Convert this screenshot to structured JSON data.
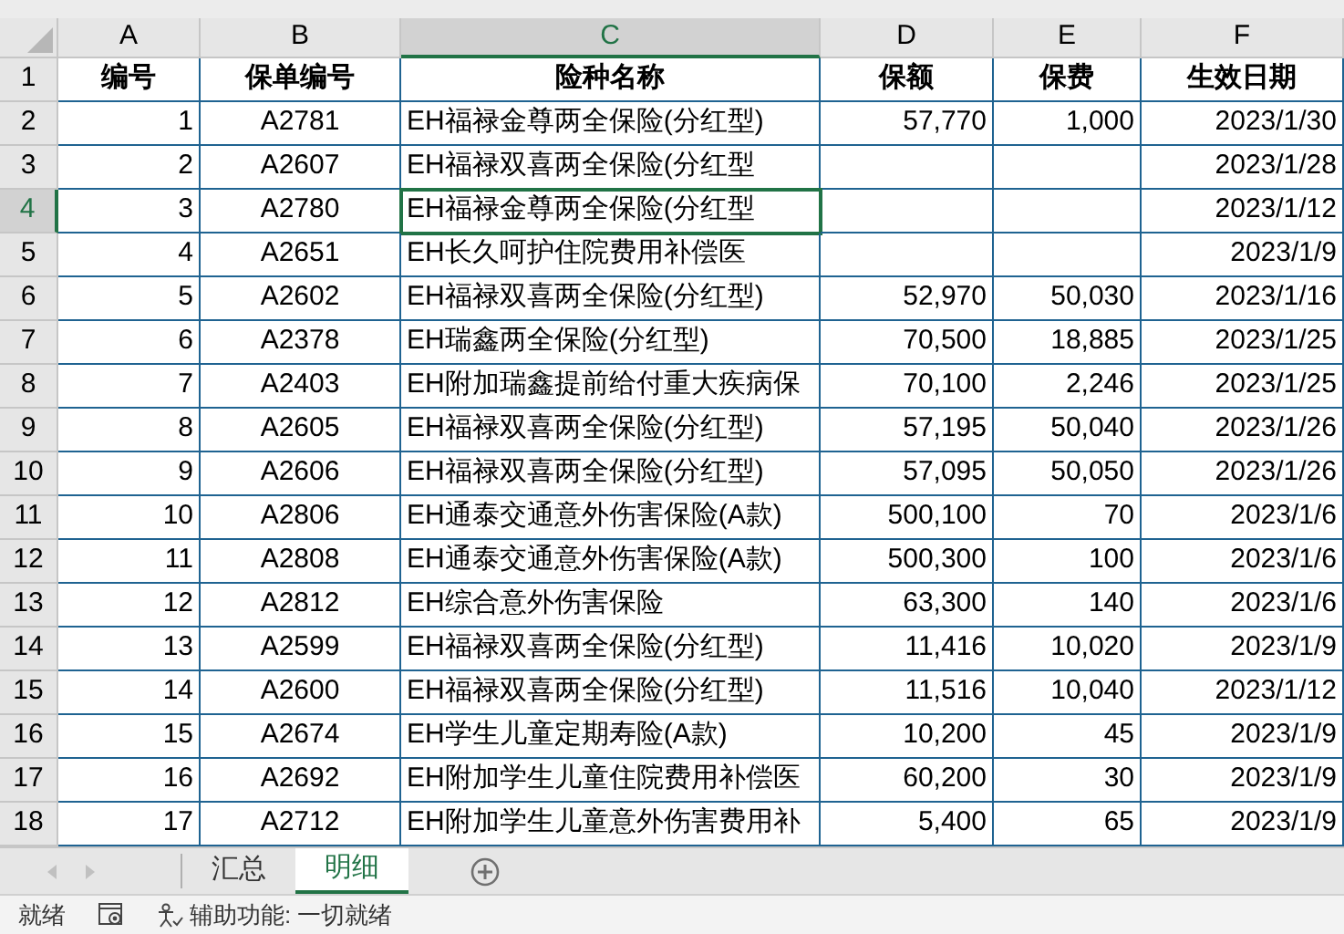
{
  "columns": [
    {
      "label": "A",
      "selected": false
    },
    {
      "label": "B",
      "selected": false
    },
    {
      "label": "C",
      "selected": true
    },
    {
      "label": "D",
      "selected": false
    },
    {
      "label": "E",
      "selected": false
    },
    {
      "label": "F",
      "selected": false
    }
  ],
  "rows": [
    {
      "number": "1",
      "kind": "header",
      "selected": false,
      "cells": [
        "编号",
        "保单编号",
        "险种名称",
        "保额",
        "保费",
        "生效日期"
      ]
    },
    {
      "number": "2",
      "kind": "data",
      "selected": false,
      "cells": [
        "1",
        "A2781",
        "EH福禄金尊两全保险(分红型)",
        "57,770",
        "1,000",
        "2023/1/30"
      ]
    },
    {
      "number": "3",
      "kind": "data",
      "selected": false,
      "cells": [
        "2",
        "A2607",
        "EH福禄双喜两全保险(分红型",
        null,
        null,
        "2023/1/28"
      ]
    },
    {
      "number": "4",
      "kind": "data",
      "selected": true,
      "cells": [
        "3",
        "A2780",
        "EH福禄金尊两全保险(分红型",
        null,
        null,
        "2023/1/12"
      ]
    },
    {
      "number": "5",
      "kind": "data",
      "selected": false,
      "cells": [
        "4",
        "A2651",
        "EH长久呵护住院费用补偿医",
        null,
        null,
        "2023/1/9"
      ]
    },
    {
      "number": "6",
      "kind": "data",
      "selected": false,
      "cells": [
        "5",
        "A2602",
        "EH福禄双喜两全保险(分红型)",
        "52,970",
        "50,030",
        "2023/1/16"
      ]
    },
    {
      "number": "7",
      "kind": "data",
      "selected": false,
      "cells": [
        "6",
        "A2378",
        "EH瑞鑫两全保险(分红型)",
        "70,500",
        "18,885",
        "2023/1/25"
      ]
    },
    {
      "number": "8",
      "kind": "data",
      "selected": false,
      "cells": [
        "7",
        "A2403",
        "EH附加瑞鑫提前给付重大疾病保",
        "70,100",
        "2,246",
        "2023/1/25"
      ]
    },
    {
      "number": "9",
      "kind": "data",
      "selected": false,
      "cells": [
        "8",
        "A2605",
        "EH福禄双喜两全保险(分红型)",
        "57,195",
        "50,040",
        "2023/1/26"
      ]
    },
    {
      "number": "10",
      "kind": "data",
      "selected": false,
      "cells": [
        "9",
        "A2606",
        "EH福禄双喜两全保险(分红型)",
        "57,095",
        "50,050",
        "2023/1/26"
      ]
    },
    {
      "number": "11",
      "kind": "data",
      "selected": false,
      "cells": [
        "10",
        "A2806",
        "EH通泰交通意外伤害保险(A款)",
        "500,100",
        "70",
        "2023/1/6"
      ]
    },
    {
      "number": "12",
      "kind": "data",
      "selected": false,
      "cells": [
        "11",
        "A2808",
        "EH通泰交通意外伤害保险(A款)",
        "500,300",
        "100",
        "2023/1/6"
      ]
    },
    {
      "number": "13",
      "kind": "data",
      "selected": false,
      "cells": [
        "12",
        "A2812",
        "EH综合意外伤害保险",
        "63,300",
        "140",
        "2023/1/6"
      ]
    },
    {
      "number": "14",
      "kind": "data",
      "selected": false,
      "cells": [
        "13",
        "A2599",
        "EH福禄双喜两全保险(分红型)",
        "11,416",
        "10,020",
        "2023/1/9"
      ]
    },
    {
      "number": "15",
      "kind": "data",
      "selected": false,
      "cells": [
        "14",
        "A2600",
        "EH福禄双喜两全保险(分红型)",
        "11,516",
        "10,040",
        "2023/1/12"
      ]
    },
    {
      "number": "16",
      "kind": "data",
      "selected": false,
      "cells": [
        "15",
        "A2674",
        "EH学生儿童定期寿险(A款)",
        "10,200",
        "45",
        "2023/1/9"
      ]
    },
    {
      "number": "17",
      "kind": "data",
      "selected": false,
      "cells": [
        "16",
        "A2692",
        "EH附加学生儿童住院费用补偿医",
        "60,200",
        "30",
        "2023/1/9"
      ]
    },
    {
      "number": "18",
      "kind": "data",
      "selected": false,
      "cells": [
        "17",
        "A2712",
        "EH附加学生儿童意外伤害费用补",
        "5,400",
        "65",
        "2023/1/9"
      ]
    }
  ],
  "sheet_tabs": [
    {
      "label": "汇总",
      "selected": false
    },
    {
      "label": "明细",
      "selected": true
    }
  ],
  "status_bar": {
    "state": "就绪",
    "accessibility": "辅助功能: 一切就绪"
  }
}
